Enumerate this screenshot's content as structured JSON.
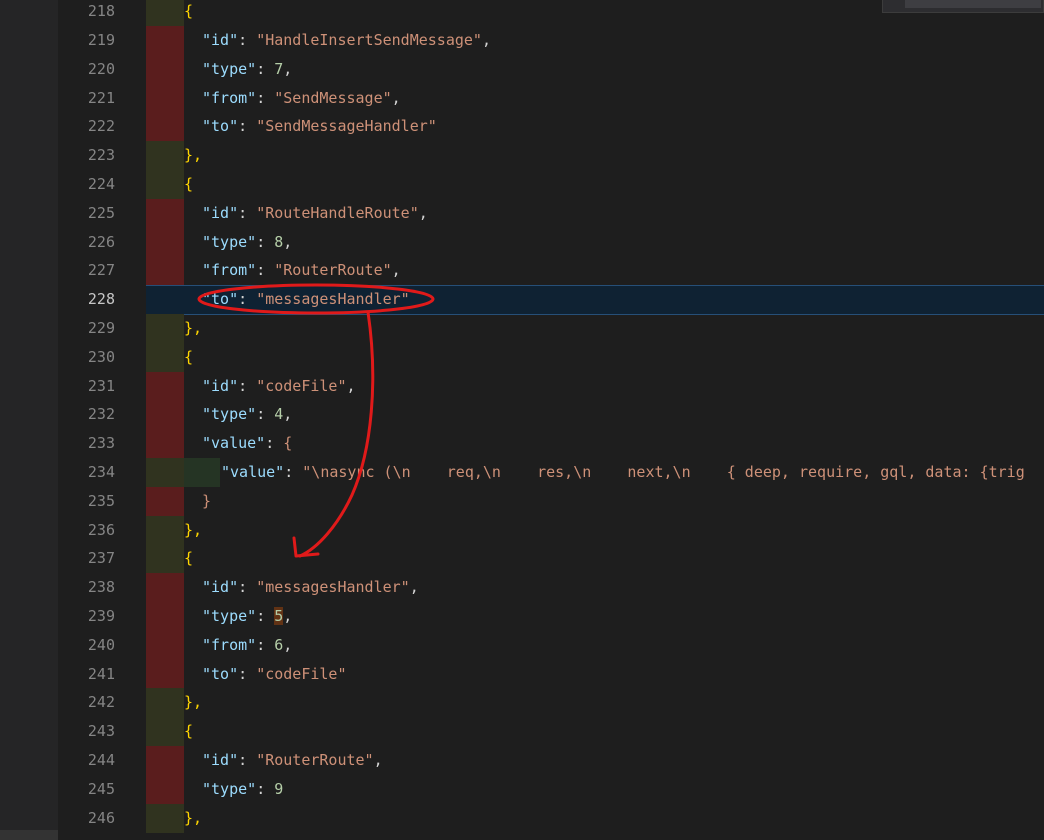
{
  "editor": {
    "lines": [
      {
        "no": "218"
      },
      {
        "no": "219"
      },
      {
        "no": "220"
      },
      {
        "no": "221"
      },
      {
        "no": "222"
      },
      {
        "no": "223"
      },
      {
        "no": "224"
      },
      {
        "no": "225"
      },
      {
        "no": "226"
      },
      {
        "no": "227"
      },
      {
        "no": "228"
      },
      {
        "no": "229"
      },
      {
        "no": "230"
      },
      {
        "no": "231"
      },
      {
        "no": "232"
      },
      {
        "no": "233"
      },
      {
        "no": "234"
      },
      {
        "no": "235"
      },
      {
        "no": "236"
      },
      {
        "no": "237"
      },
      {
        "no": "238"
      },
      {
        "no": "239"
      },
      {
        "no": "240"
      },
      {
        "no": "241"
      },
      {
        "no": "242"
      },
      {
        "no": "243"
      },
      {
        "no": "244"
      },
      {
        "no": "245"
      },
      {
        "no": "246"
      }
    ],
    "tokens": {
      "open": "{",
      "close": "},",
      "close_inner": "}",
      "colon": ": ",
      "comma": ",",
      "k_id": "\"id\"",
      "k_type": "\"type\"",
      "k_from": "\"from\"",
      "k_to": "\"to\"",
      "k_value": "\"value\"",
      "s_HandleInsertSendMessage": "\"HandleInsertSendMessage\"",
      "n_7": "7",
      "s_SendMessage": "\"SendMessage\"",
      "s_SendMessageHandler": "\"SendMessageHandler\"",
      "s_RouteHandleRoute": "\"RouteHandleRoute\"",
      "n_8": "8",
      "s_RouterRoute": "\"RouterRoute\"",
      "s_messagesHandler": "\"messagesHandler\"",
      "s_codeFile": "\"codeFile\"",
      "n_4": "4",
      "s_code_value": "\"\\nasync (\\n    req,\\n    res,\\n    next,\\n    { deep, require, gql, data: {trig",
      "n_5": "5",
      "n_6": "6",
      "n_9": "9"
    }
  },
  "colors": {
    "background": "#1e1e1e",
    "key": "#9cdcfe",
    "string": "#ce9178",
    "number": "#b5cea8",
    "diff_removed": "#5a1d1d",
    "annotation": "#e01a1a"
  }
}
